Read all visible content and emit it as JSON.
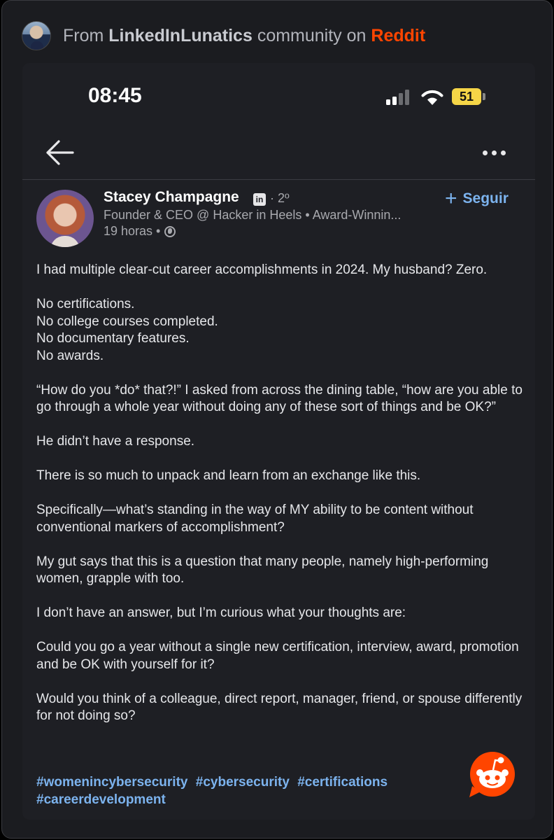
{
  "header": {
    "prefix": "From ",
    "community": "LinkedInLunatics",
    "middle": " community on ",
    "platform": "Reddit"
  },
  "status_bar": {
    "time": "08:45",
    "battery": "51"
  },
  "post": {
    "author_name": "Stacey Champagne",
    "linkedin_badge": "in",
    "degree": "· 2º",
    "headline": "Founder & CEO @ Hacker in Heels • Award-Winnin...",
    "time": "19 horas •",
    "follow_label": "Seguir",
    "follow_icon": "+",
    "paragraphs": [
      "I had multiple clear-cut career accomplishments in 2024. My husband? Zero.",
      "No certifications.",
      "No college courses completed.",
      "No documentary features.",
      "No awards.",
      "“How do you *do* that?!” I asked from across the dining table, “how are you able to go through a whole year without doing any of these sort of things and be OK?”",
      "He didn’t have a response.",
      "There is so much to unpack and learn from an exchange like this.",
      "Specifically—what’s standing in the way of MY ability to be content without conventional markers of accomplishment?",
      "My gut says that this is a question that many people, namely high-performing women, grapple with too.",
      "I don’t have an answer, but I’m curious what your thoughts are:",
      "Could you go a year without a single new certification, interview, award, promotion and be OK with yourself for it?",
      "Would you think of a colleague, direct report, manager, friend, or spouse differently for not doing so?"
    ],
    "hashtags": [
      "#womenincybersecurity",
      "#cybersecurity",
      "#certifications",
      "#careerdevelopment"
    ]
  },
  "icons": {
    "back": "back-arrow-icon",
    "more": "more-options-icon",
    "globe": "globe-icon",
    "snoo": "reddit-snoo-icon"
  },
  "colors": {
    "reddit": "#ff4500",
    "link": "#7cb3ee",
    "battery": "#f5d547",
    "background": "#1e1f24"
  }
}
